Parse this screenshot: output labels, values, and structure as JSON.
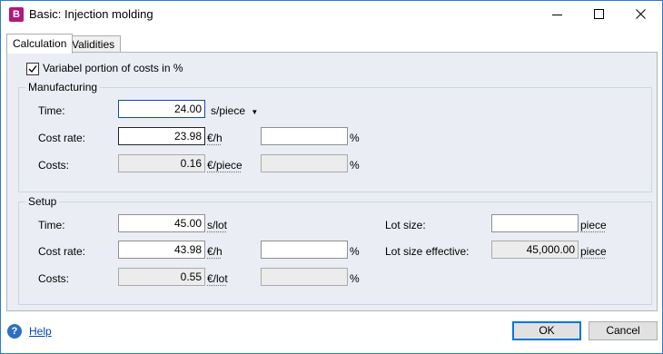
{
  "window": {
    "app_icon_letter": "B",
    "title": "Basic: Injection molding"
  },
  "tabs": [
    {
      "label": "Calculation",
      "active": true
    },
    {
      "label": "Validities",
      "active": false
    }
  ],
  "variable_costs": {
    "label": "Variabel portion of costs in %",
    "checked": true
  },
  "manufacturing": {
    "title": "Manufacturing",
    "time": {
      "label": "Time:",
      "value": "24.00",
      "unit": "s/piece"
    },
    "cost_rate": {
      "label": "Cost rate:",
      "value": "23.98",
      "unit": "€/h",
      "pct_value": "",
      "pct": "%"
    },
    "costs": {
      "label": "Costs:",
      "value": "0.16",
      "unit": "€/piece",
      "pct_value": "",
      "pct": "%"
    }
  },
  "setup": {
    "title": "Setup",
    "time": {
      "label": "Time:",
      "value": "45.00",
      "unit": "s/lot"
    },
    "cost_rate": {
      "label": "Cost rate:",
      "value": "43.98",
      "unit": "€/h",
      "pct_value": "",
      "pct": "%"
    },
    "costs": {
      "label": "Costs:",
      "value": "0.55",
      "unit": "€/lot",
      "pct_value": "",
      "pct": "%"
    },
    "lot_size": {
      "label": "Lot size:",
      "value": "",
      "unit": "piece"
    },
    "lot_size_effective": {
      "label": "Lot size effective:",
      "value": "45,000.00",
      "unit": "piece"
    }
  },
  "footer": {
    "help_label": "Help",
    "ok_label": "OK",
    "cancel_label": "Cancel"
  },
  "colors": {
    "accent": "#0078d7",
    "panel_bg": "#eaeef4",
    "app_icon": "#b0187c"
  }
}
